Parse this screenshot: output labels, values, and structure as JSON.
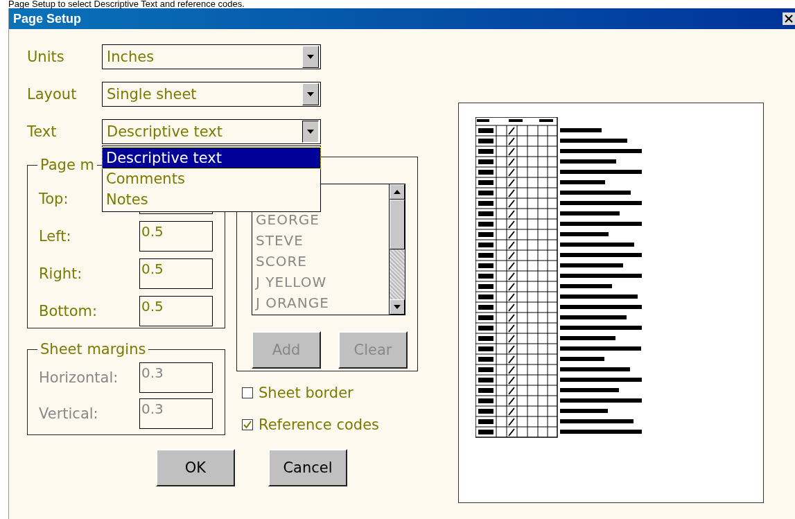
{
  "caption": "Page Setup to select Descriptive Text and reference codes.",
  "window": {
    "title": "Page Setup"
  },
  "fields": [
    {
      "label": "Units",
      "value": "Inches",
      "open": false
    },
    {
      "label": "Layout",
      "value": "Single sheet",
      "open": false
    },
    {
      "label": "Text",
      "value": "Descriptive text",
      "open": true
    }
  ],
  "dropdown": {
    "items": [
      {
        "label": "Descriptive text",
        "selected": true
      },
      {
        "label": "Comments",
        "selected": false
      },
      {
        "label": "Notes",
        "selected": false
      }
    ]
  },
  "page_margins": {
    "legend": "Page m",
    "fields": [
      {
        "label": "Top:"
      },
      {
        "label": "Left:",
        "value": "0.5"
      },
      {
        "label": "Right:",
        "value": "0.5"
      },
      {
        "label": "Bottom:",
        "value": "0.5"
      }
    ]
  },
  "names": {
    "disabled": true,
    "items": [
      "GEORGE",
      "STEVE",
      "SCORE",
      "J YELLOW",
      "J ORANGE"
    ],
    "buttons": [
      {
        "label": "Add",
        "disabled": true
      },
      {
        "label": "Clear",
        "disabled": true
      }
    ]
  },
  "sheet_margins": {
    "legend": "Sheet margins",
    "disabled": true,
    "fields": [
      {
        "label": "Horizontal:",
        "value": "0.3"
      },
      {
        "label": "Vertical:",
        "value": "0.3"
      }
    ]
  },
  "checkboxes": [
    {
      "label": "Sheet border",
      "checked": false
    },
    {
      "label": "Reference codes",
      "checked": true
    }
  ],
  "buttons": [
    {
      "label": "OK"
    },
    {
      "label": "Cancel"
    }
  ]
}
